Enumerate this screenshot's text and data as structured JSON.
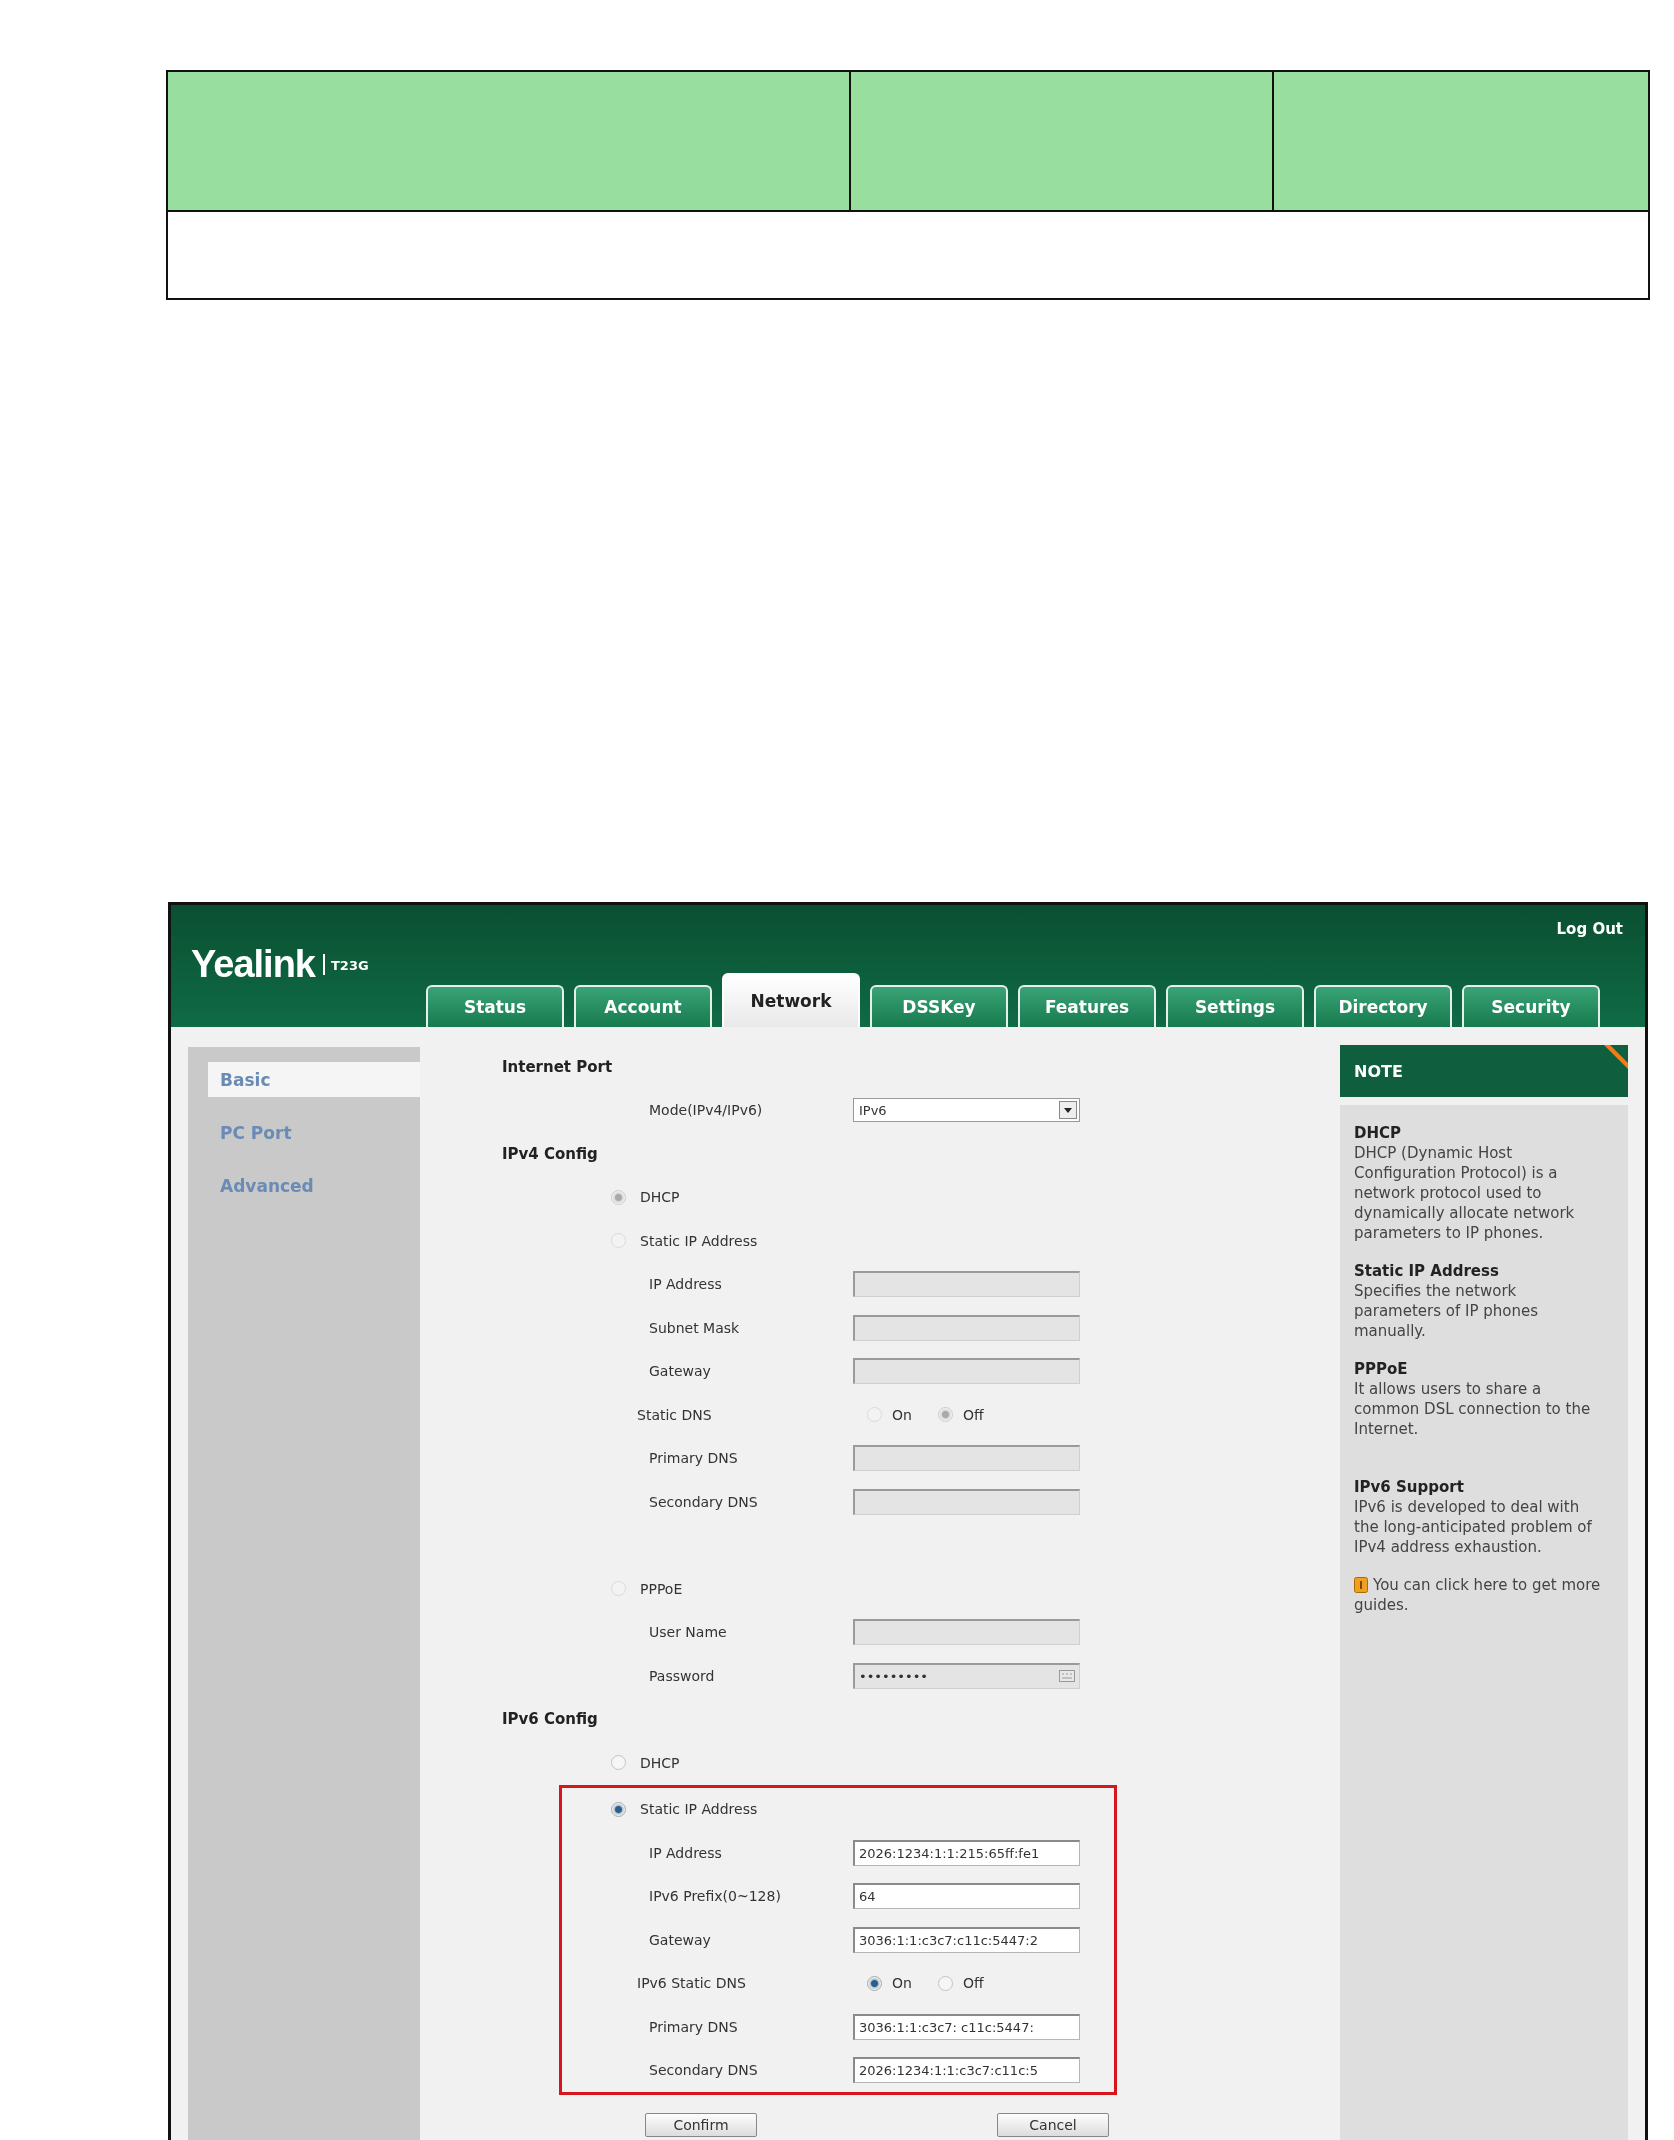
{
  "header": {
    "logo": "Yealink",
    "model": "T23G",
    "logout": "Log Out"
  },
  "tabs": [
    {
      "label": "Status",
      "selected": false
    },
    {
      "label": "Account",
      "selected": false
    },
    {
      "label": "Network",
      "selected": true
    },
    {
      "label": "DSSKey",
      "selected": false
    },
    {
      "label": "Features",
      "selected": false
    },
    {
      "label": "Settings",
      "selected": false
    },
    {
      "label": "Directory",
      "selected": false
    },
    {
      "label": "Security",
      "selected": false
    }
  ],
  "sidebar": {
    "items": [
      {
        "label": "Basic",
        "selected": true
      },
      {
        "label": "PC Port",
        "selected": false
      },
      {
        "label": "Advanced",
        "selected": false
      }
    ]
  },
  "form": {
    "sections": [
      {
        "heading": "Internet Port",
        "items": [
          {
            "kind": "select",
            "label": "Mode(IPv4/IPv6)",
            "value": "IPv6"
          }
        ]
      },
      {
        "heading": "IPv4 Config",
        "items": [
          {
            "kind": "option",
            "label": "DHCP",
            "selected": true,
            "disabled": true,
            "highlighted": false
          },
          {
            "kind": "option",
            "label": "Static IP Address",
            "selected": false,
            "disabled": true,
            "highlighted": false,
            "fields": [
              {
                "kind": "text",
                "label": "IP Address",
                "disabled": true
              },
              {
                "kind": "text",
                "label": "Subnet Mask",
                "disabled": true
              },
              {
                "kind": "text",
                "label": "Gateway",
                "disabled": true
              },
              {
                "kind": "toggle",
                "label": "Static DNS",
                "disabled": true,
                "options": [
                  {
                    "label": "On",
                    "selected": false
                  },
                  {
                    "label": "Off",
                    "selected": true
                  }
                ]
              },
              {
                "kind": "text",
                "label": "Primary DNS",
                "disabled": true
              },
              {
                "kind": "text",
                "label": "Secondary DNS",
                "disabled": true
              }
            ]
          },
          {
            "kind": "option",
            "label": "PPPoE",
            "selected": false,
            "disabled": true,
            "highlighted": false,
            "fields": [
              {
                "kind": "text",
                "label": "User Name",
                "disabled": true
              },
              {
                "kind": "password",
                "label": "Password",
                "disabled": true,
                "value": "•••••••••"
              }
            ]
          }
        ]
      },
      {
        "heading": "IPv6 Config",
        "items": [
          {
            "kind": "option",
            "label": "DHCP",
            "selected": false,
            "disabled": false,
            "highlighted": false
          },
          {
            "kind": "option",
            "label": "Static IP Address",
            "selected": true,
            "disabled": false,
            "highlighted": true,
            "fields": [
              {
                "kind": "text",
                "label": "IP Address",
                "disabled": false,
                "value": "2026:1234:1:1:215:65ff:fe1"
              },
              {
                "kind": "text",
                "label": "IPv6 Prefix(0~128)",
                "disabled": false,
                "value": "64"
              },
              {
                "kind": "text",
                "label": "Gateway",
                "disabled": false,
                "value": "3036:1:1:c3c7:c11c:5447:2"
              },
              {
                "kind": "toggle",
                "label": "IPv6 Static DNS",
                "disabled": false,
                "options": [
                  {
                    "label": "On",
                    "selected": true
                  },
                  {
                    "label": "Off",
                    "selected": false
                  }
                ]
              },
              {
                "kind": "text",
                "label": "Primary DNS",
                "disabled": false,
                "value": "3036:1:1:c3c7: c11c:5447:"
              },
              {
                "kind": "text",
                "label": "Secondary DNS",
                "disabled": false,
                "value": "2026:1234:1:1:c3c7:c11c:5"
              }
            ]
          }
        ]
      }
    ],
    "buttons": [
      "Confirm",
      "Cancel"
    ]
  },
  "note": {
    "title": "NOTE",
    "sections": [
      {
        "heading": "DHCP",
        "text": "DHCP (Dynamic Host Configuration Protocol) is a network protocol used to dynamically allocate network parameters to IP phones."
      },
      {
        "heading": "Static IP Address",
        "text": "Specifies the network parameters of IP phones manually."
      },
      {
        "heading": "PPPoE",
        "text": "It allows users to share a common DSL connection to the Internet."
      },
      {
        "heading": "IPv6 Support",
        "text": "IPv6 is developed to deal with the long-anticipated problem of IPv4 address exhaustion."
      }
    ],
    "guide": "You can click here to get more guides."
  }
}
